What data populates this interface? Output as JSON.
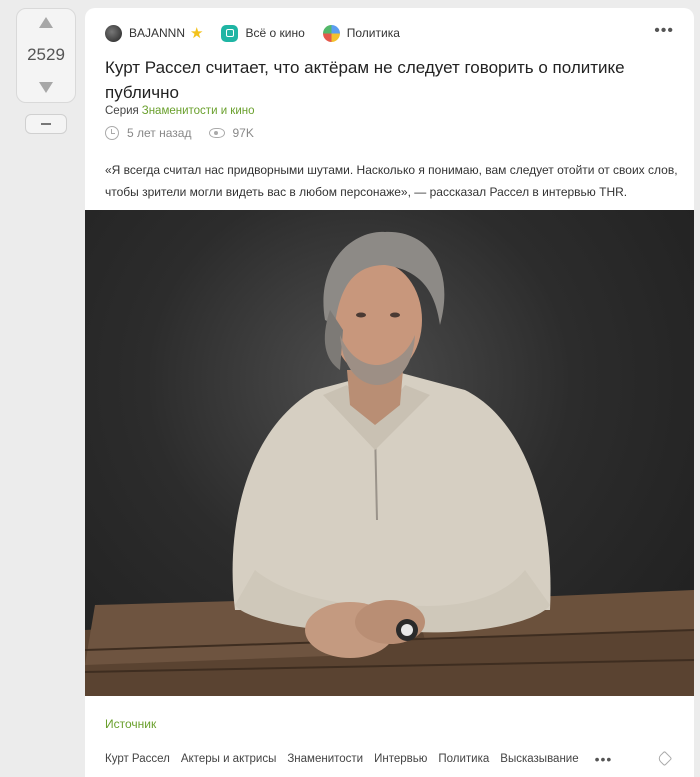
{
  "vote": {
    "count": "2529"
  },
  "post": {
    "author": "BAJANNN",
    "community": "Всё о кино",
    "category": "Политика",
    "title": "Курт Рассел считает, что актёрам не следует говорить о политике публично",
    "series_label": "Серия",
    "series_name": "Знаменитости и кино",
    "time": "5 лет назад",
    "views": "97K",
    "text": "«Я всегда считал нас придворными шутами. Насколько я понимаю, вам следует отойти от своих слов, чтобы зрители могли видеть вас в любом персонаже», — рассказал Рассел в интервью THR.",
    "source_label": "Источник",
    "tags": [
      "Курт Рассел",
      "Актеры и актрисы",
      "Знаменитости",
      "Интервью",
      "Политика",
      "Высказывание"
    ]
  },
  "icons": {
    "vote_up": "triangle-up-icon",
    "vote_down": "triangle-down-icon",
    "author_avatar": "avatar-icon",
    "rating": "star-icon",
    "community": "film-icon",
    "category": "globe-icon",
    "time": "clock-icon",
    "views": "eye-icon",
    "more": "ellipsis-icon",
    "tags": "tag-icon"
  },
  "colors": {
    "accent_green": "#6aa02d",
    "star": "#f3c21b",
    "background": "#ececec"
  }
}
